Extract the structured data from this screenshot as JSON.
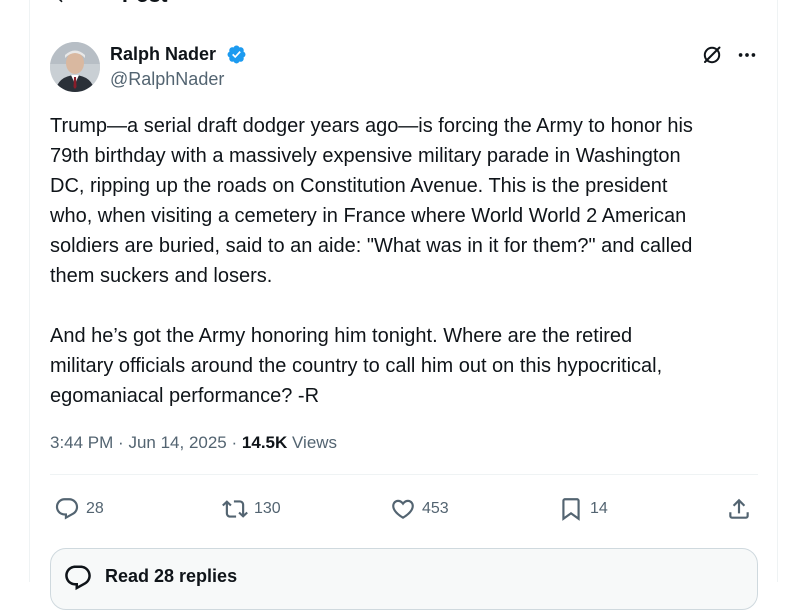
{
  "header": {
    "title": "Post"
  },
  "author": {
    "name": "Ralph Nader",
    "handle": "@RalphNader"
  },
  "tweet": {
    "text": "Trump—a serial draft dodger years ago—is forcing the Army to honor his\n79th birthday with a massively expensive military parade in Washington\nDC, ripping up the roads on Constitution Avenue. This is the president\nwho, when visiting a cemetery in France where World World 2 American\nsoldiers are buried, said to an aide: \"What was in it for them?\" and called\nthem suckers and losers.\n\nAnd he’s got the Army honoring him tonight. Where are the retired\nmilitary officials around the country to call him out on this hypocritical,\negomaniacal performance? -R",
    "time": "3:44 PM",
    "date": "Jun 14, 2025",
    "views_count": "14.5K",
    "views_label": "Views",
    "separator": "·"
  },
  "actions": {
    "replies": "28",
    "reposts": "130",
    "likes": "453",
    "bookmarks": "14"
  },
  "replies_button": {
    "label": "Read 28 replies"
  },
  "colors": {
    "text": "#0f1419",
    "secondary": "#536471",
    "verified": "#1d9bf0",
    "border": "#eff3f4"
  }
}
